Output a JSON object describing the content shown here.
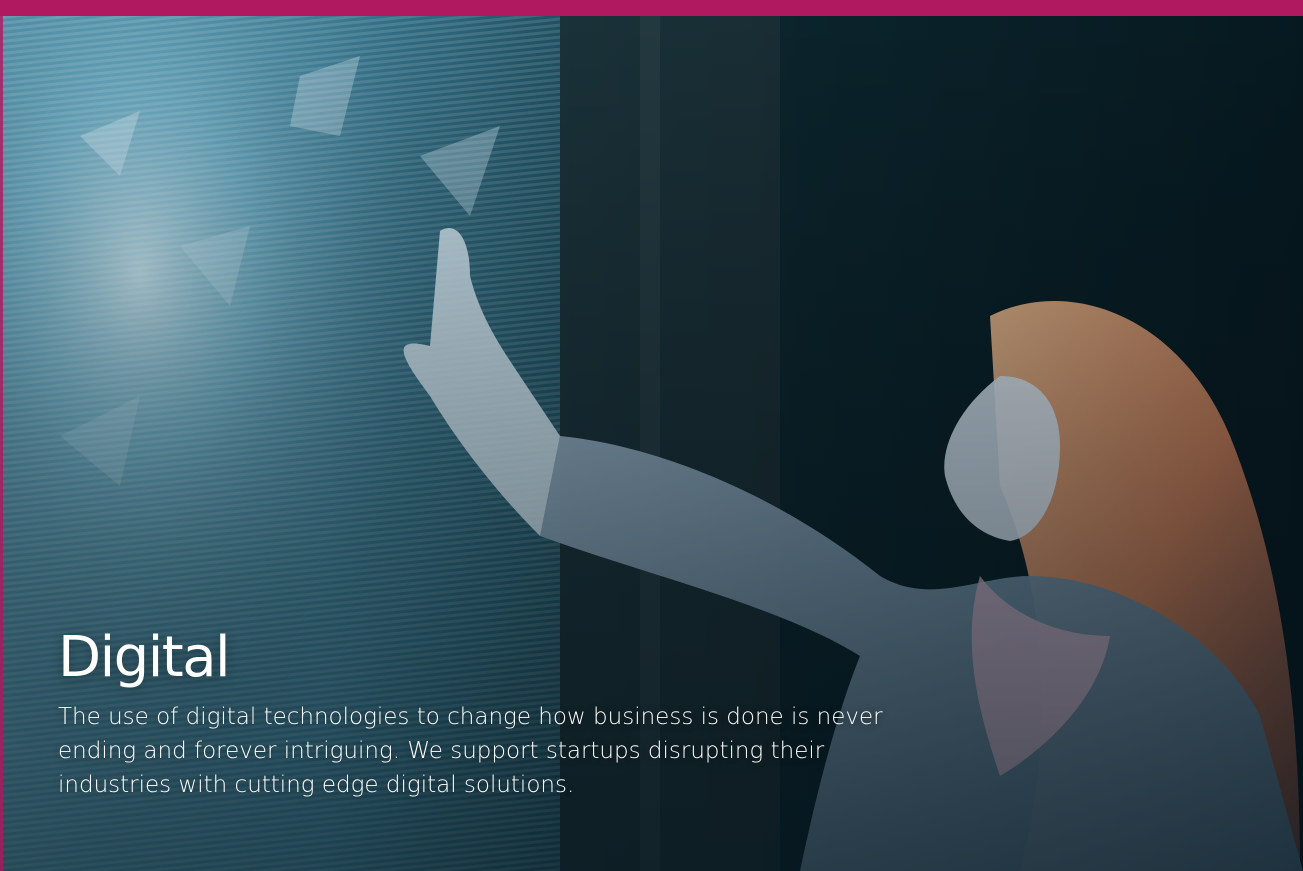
{
  "colors": {
    "accent": "#b0185f",
    "text": "#ffffff"
  },
  "hero": {
    "image": "woman-touching-digital-screen-image",
    "title": "Digital",
    "description": "The use of digital technologies to change how business is done is never ending and forever intriguing. We support startups disrupting their industries with cutting edge digital solutions."
  }
}
